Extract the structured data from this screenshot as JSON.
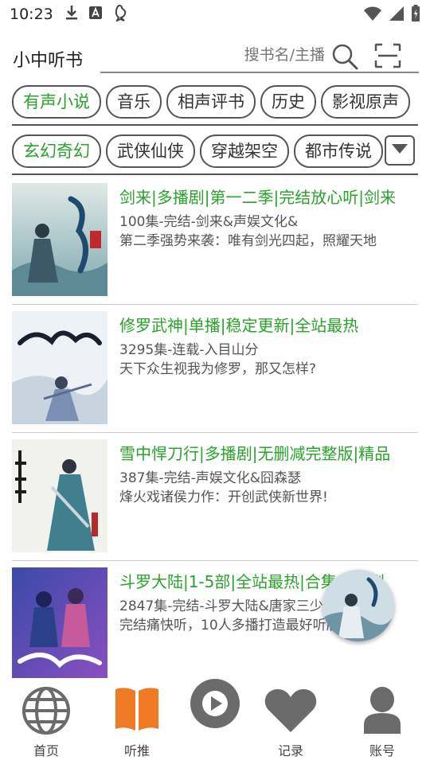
{
  "status_bar": {
    "time": "10:23"
  },
  "header": {
    "title": "小中听书",
    "search_placeholder": "搜书名/主播"
  },
  "categories": [
    "有声小说",
    "音乐",
    "相声评书",
    "历史",
    "影视原声"
  ],
  "subcategories": [
    "玄幻奇幻",
    "武侠仙侠",
    "穿越架空",
    "都市传说"
  ],
  "books": [
    {
      "title": "剑来|多播剧|第一二季|完结放心听|剑来",
      "meta": "100集-完结-剑来&声娱文化&",
      "desc": "第二季强势来袭：唯有剑光四起，照耀天地"
    },
    {
      "title": "修罗武神|单播|稳定更新|全站最热",
      "meta": "3295集-连载-入目山分",
      "desc": "天下众生视我为修罗，那又怎样?"
    },
    {
      "title": "雪中悍刀行|多播剧|无删减完整版|精品",
      "meta": "387集-完结-声娱文化&囧森瑟",
      "desc": "烽火戏诸侯力作：开创武侠新世界!"
    },
    {
      "title": "斗罗大陆|1-5部|全站最热|合集多播剧",
      "meta": "2847集-完结-斗罗大陆&唐家三少",
      "desc": "完结痛快听，10人多播打造最好听版本!"
    }
  ],
  "nav": {
    "home": "首页",
    "recommend": "听推",
    "history": "记录",
    "account": "账号"
  },
  "colors": {
    "accent_green": "#2aa32a",
    "active_orange": "#f07a24",
    "icon_gray": "#6b6b6b"
  }
}
